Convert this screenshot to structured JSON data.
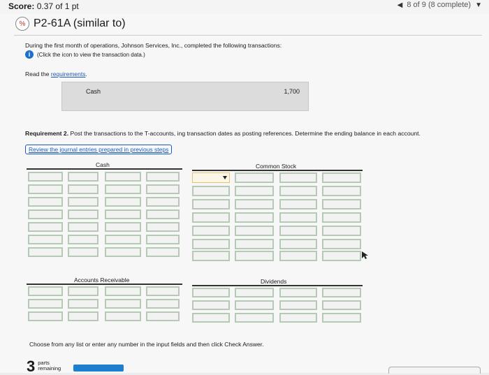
{
  "header": {
    "score_label": "Score:",
    "score_value": "0.37 of 1 pt",
    "progress": "8 of 9 (8 complete)"
  },
  "problem": {
    "title": "P2-61A (similar to)"
  },
  "instructions": {
    "text": "During the first month of operations, Johnson Services, Inc., completed the following transactions:",
    "info_link": "(Click the icon to view the transaction data.)",
    "read_prefix": "Read the ",
    "read_link": "requirements",
    "read_suffix": "."
  },
  "cash_panel": {
    "label": "Cash",
    "value": "1,700"
  },
  "requirement2": {
    "label": "Requirement 2.",
    "text": " Post the transactions to the T-accounts, ing transaction dates as posting references. Determine the ending balance in each account.",
    "review_link": "Review the journal entries prepared in previous steps"
  },
  "t_accounts": {
    "cash": "Cash",
    "common_stock": "Common Stock",
    "accounts_receivable": "Accounts Receivable",
    "dividends": "Dividends"
  },
  "footer": {
    "choose": "Choose from any list or enter any number in the input fields and then click Check Answer.",
    "parts_num": "3",
    "parts_line1": "parts",
    "parts_line2": "remaining"
  },
  "colors": {
    "accent": "#1e7fd0",
    "link": "#1e5bb8",
    "cell_border": "#b5c9b5"
  }
}
